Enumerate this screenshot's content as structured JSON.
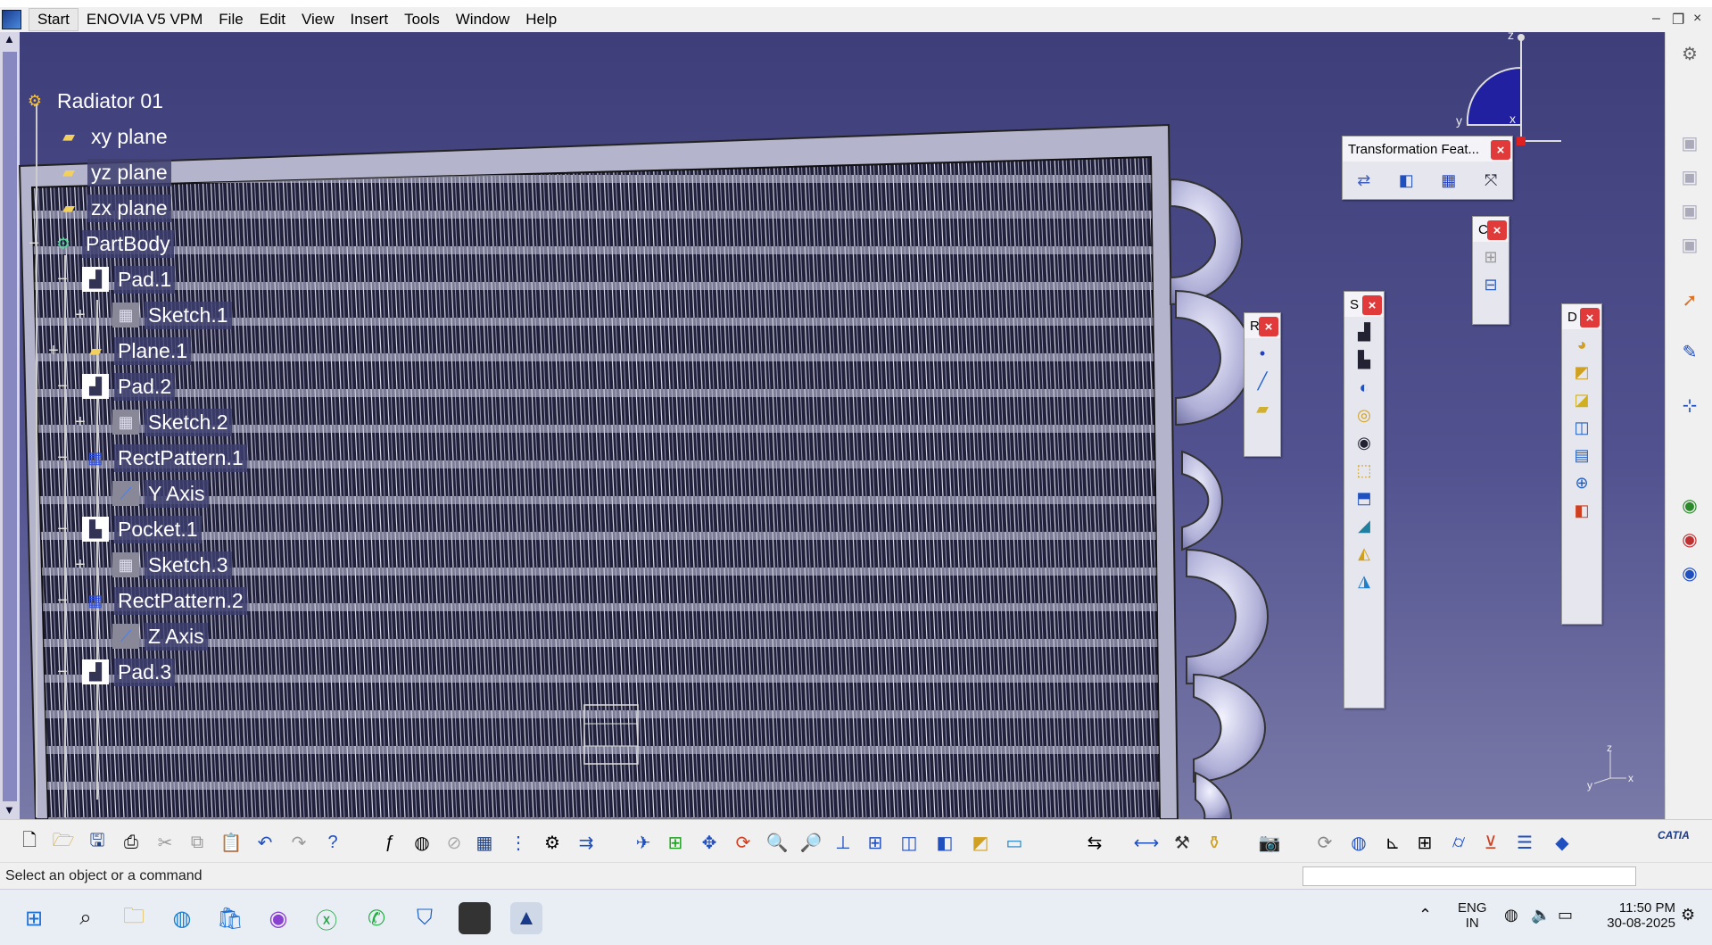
{
  "menubar": {
    "items": [
      "Start",
      "ENOVIA V5 VPM",
      "File",
      "Edit",
      "View",
      "Insert",
      "Tools",
      "Window",
      "Help"
    ],
    "window_controls": [
      "–",
      "❐",
      "×"
    ]
  },
  "tree": {
    "root": "Radiator 01",
    "nodes": [
      "xy plane",
      "yz plane",
      "zx plane",
      "PartBody",
      "Pad.1",
      "Sketch.1",
      "Plane.1",
      "Pad.2",
      "Sketch.2",
      "RectPattern.1",
      "Y Axis",
      "Pocket.1",
      "Sketch.3",
      "RectPattern.2",
      "Z Axis",
      "Pad.3"
    ]
  },
  "toolbars": {
    "transformation": {
      "title": "Transformation Feat..."
    },
    "c_toolbar": {
      "title": "C"
    },
    "r_toolbar": {
      "title": "R"
    },
    "s_toolbar": {
      "title": "S"
    },
    "d_toolbar": {
      "title": "D"
    },
    "close_glyph": "×"
  },
  "compass": {
    "z": "z",
    "x": "x",
    "y": "y"
  },
  "axis_triad": {
    "z": "z",
    "x": "x",
    "y": "y"
  },
  "status": {
    "message": "Select an object or a command"
  },
  "taskbar": {
    "lang_top": "ENG",
    "lang_bottom": "IN",
    "time": "11:50 PM",
    "date": "30-08-2025"
  },
  "brand": {
    "catia": "CATIA"
  },
  "colors": {
    "viewport_top": "#3e3e7a",
    "viewport_bottom": "#7a7aa8",
    "close_red": "#e03a3a",
    "tree_label_bg": "#3e3e6e"
  }
}
